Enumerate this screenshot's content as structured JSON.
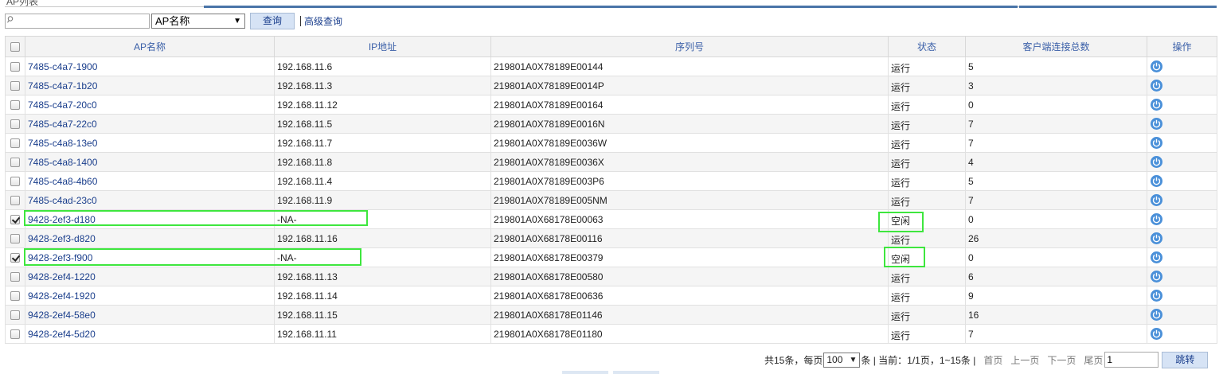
{
  "panel": {
    "title": "AP列表"
  },
  "search": {
    "value": "",
    "field_selected": "AP名称",
    "query_label": "查询",
    "advanced_label": "高级查询"
  },
  "table": {
    "columns": [
      "AP名称",
      "IP地址",
      "序列号",
      "状态",
      "客户端连接总数",
      "操作"
    ],
    "rows": [
      {
        "checked": false,
        "name": "7485-c4a7-1900",
        "ip": "192.168.11.6",
        "serial": "219801A0X78189E00144",
        "status": "运行",
        "clients": "5"
      },
      {
        "checked": false,
        "name": "7485-c4a7-1b20",
        "ip": "192.168.11.3",
        "serial": "219801A0X78189E0014P",
        "status": "运行",
        "clients": "3"
      },
      {
        "checked": false,
        "name": "7485-c4a7-20c0",
        "ip": "192.168.11.12",
        "serial": "219801A0X78189E00164",
        "status": "运行",
        "clients": "0"
      },
      {
        "checked": false,
        "name": "7485-c4a7-22c0",
        "ip": "192.168.11.5",
        "serial": "219801A0X78189E0016N",
        "status": "运行",
        "clients": "7"
      },
      {
        "checked": false,
        "name": "7485-c4a8-13e0",
        "ip": "192.168.11.7",
        "serial": "219801A0X78189E0036W",
        "status": "运行",
        "clients": "7"
      },
      {
        "checked": false,
        "name": "7485-c4a8-1400",
        "ip": "192.168.11.8",
        "serial": "219801A0X78189E0036X",
        "status": "运行",
        "clients": "4"
      },
      {
        "checked": false,
        "name": "7485-c4a8-4b60",
        "ip": "192.168.11.4",
        "serial": "219801A0X78189E003P6",
        "status": "运行",
        "clients": "5"
      },
      {
        "checked": false,
        "name": "7485-c4ad-23c0",
        "ip": "192.168.11.9",
        "serial": "219801A0X78189E005NM",
        "status": "运行",
        "clients": "7"
      },
      {
        "checked": true,
        "name": "9428-2ef3-d180",
        "ip": "-NA-",
        "serial": "219801A0X68178E00063",
        "status": "空闲",
        "clients": "0"
      },
      {
        "checked": false,
        "name": "9428-2ef3-d820",
        "ip": "192.168.11.16",
        "serial": "219801A0X68178E00116",
        "status": "运行",
        "clients": "26"
      },
      {
        "checked": true,
        "name": "9428-2ef3-f900",
        "ip": "-NA-",
        "serial": "219801A0X68178E00379",
        "status": "空闲",
        "clients": "0"
      },
      {
        "checked": false,
        "name": "9428-2ef4-1220",
        "ip": "192.168.11.13",
        "serial": "219801A0X68178E00580",
        "status": "运行",
        "clients": "6"
      },
      {
        "checked": false,
        "name": "9428-2ef4-1920",
        "ip": "192.168.11.14",
        "serial": "219801A0X68178E00636",
        "status": "运行",
        "clients": "9"
      },
      {
        "checked": false,
        "name": "9428-2ef4-58e0",
        "ip": "192.168.11.15",
        "serial": "219801A0X68178E01146",
        "status": "运行",
        "clients": "16"
      },
      {
        "checked": false,
        "name": "9428-2ef4-5d20",
        "ip": "192.168.11.11",
        "serial": "219801A0X68178E01180",
        "status": "运行",
        "clients": "7"
      }
    ]
  },
  "pager": {
    "total_prefix": "共15条，每页",
    "page_size": "100",
    "after_size": "条 | 当前：1/1页，1~15条 |",
    "first": "首页",
    "prev": "上一页",
    "next": "下一页",
    "last": "尾页",
    "page_input": "1",
    "jump": "跳转"
  },
  "colors": {
    "link": "#1a3e8c",
    "header_text": "#3a5fa8",
    "highlight": "#3ee63e",
    "power_icon": "#4a90d9",
    "button_bg": "#d6e3f5"
  },
  "icons": {
    "row_action": "power-icon",
    "search": "search-icon"
  }
}
